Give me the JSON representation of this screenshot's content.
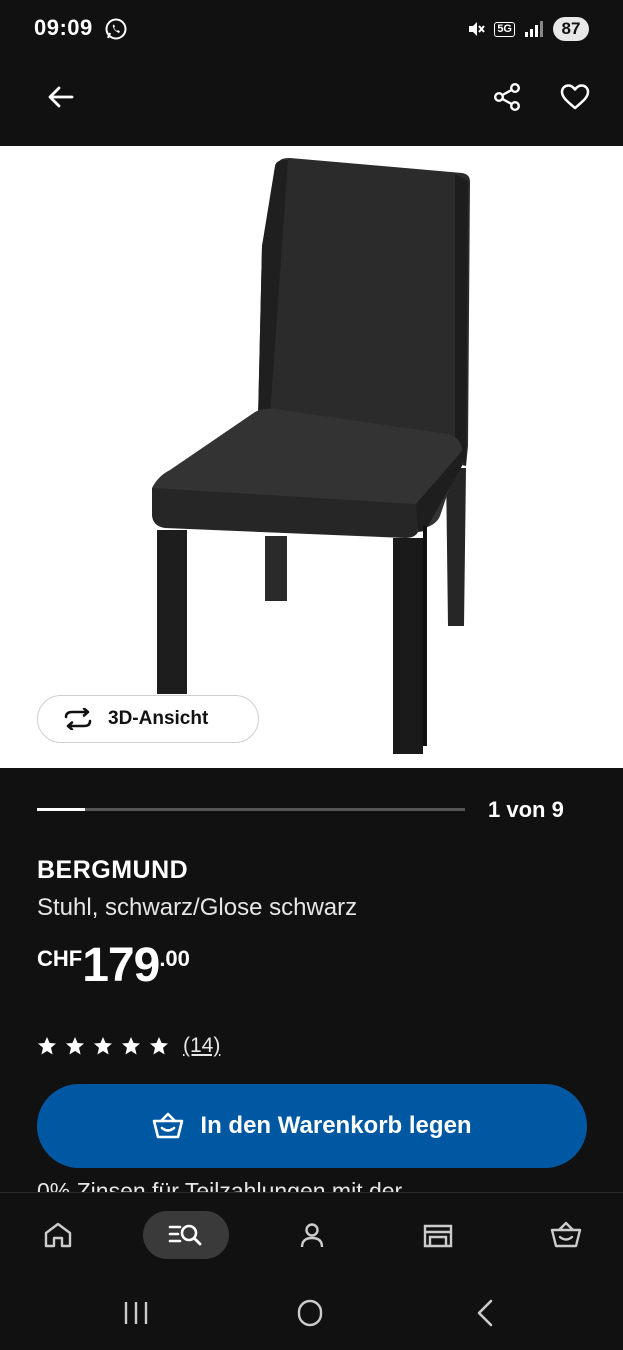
{
  "status_bar": {
    "time": "09:09",
    "network": "5G",
    "battery": "87",
    "icons": [
      "whatsapp-icon",
      "mute-icon",
      "signal-icon"
    ]
  },
  "app_bar": {
    "icons": [
      "back-arrow-icon",
      "share-icon",
      "heart-icon"
    ]
  },
  "gallery": {
    "view_3d_label": "3D-Ansicht",
    "counter": "1 von 9",
    "current_index": 1,
    "total": 9
  },
  "product": {
    "name": "BERGMUND",
    "description": "Stuhl, schwarz/Glose schwarz",
    "price_currency": "CHF",
    "price_integer": "179",
    "price_decimal": ".00",
    "rating_stars": 5,
    "review_count": "(14)"
  },
  "cart": {
    "button_label": "In den Warenkorb legen"
  },
  "finance": {
    "text": "0% Zinsen für Teilzahlungen mit der"
  },
  "bottom_nav": {
    "items": [
      "home-icon",
      "search-list-icon",
      "profile-icon",
      "store-icon",
      "cart-icon"
    ],
    "active": "search-list-icon"
  },
  "colors": {
    "background": "#111111",
    "accent": "#0058a3",
    "image_background": "#ffffff"
  }
}
